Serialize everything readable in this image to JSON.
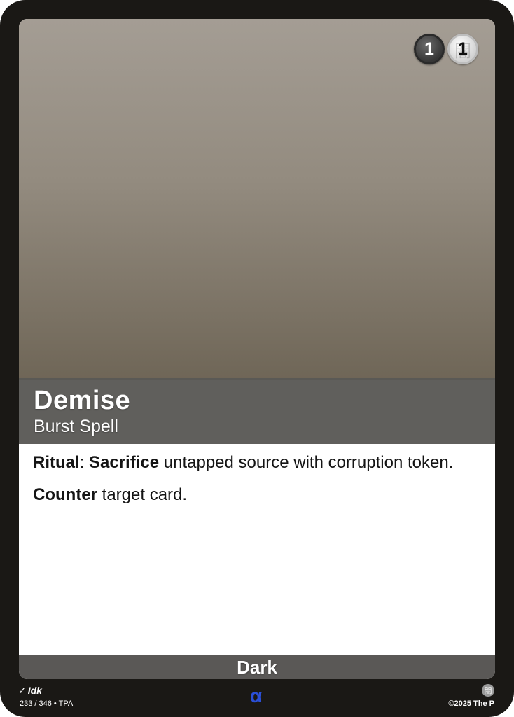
{
  "card": {
    "name": "Demise",
    "type_line": "Burst Spell",
    "cost": {
      "generic": "1",
      "element": "1",
      "element_glyph": "闇"
    },
    "rules_text": [
      {
        "keyword": "Ritual",
        "sep": ": ",
        "keyword2": "Sacrifice",
        "rest": " untapped source with corruption token."
      },
      {
        "keyword": "Counter",
        "rest": " target card."
      }
    ],
    "element": "Dark",
    "artist": "Idk",
    "set_info": "233 / 346 • TPA",
    "rarity_symbol": "α",
    "corner_glyph": "闇",
    "copyright": "©2025 The P"
  },
  "colors": {
    "frame": "#1a1815",
    "title_band": "#5a5856",
    "rarity": "#2b4fd6"
  },
  "icons": {
    "brush": "brush-icon",
    "generic_cost": "generic-cost-icon",
    "element_cost": "dark-element-cost-icon",
    "element": "dark-element-icon"
  }
}
